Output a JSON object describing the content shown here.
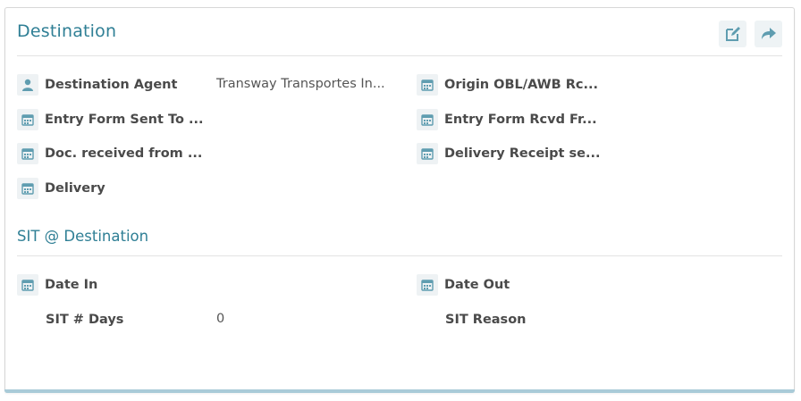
{
  "panel": {
    "title": "Destination",
    "actions": {
      "edit_icon": "edit-icon",
      "forward_icon": "share-forward-icon"
    }
  },
  "destination": {
    "left": [
      {
        "icon": "user-icon",
        "label": "Destination Agent",
        "value": "Transway Transportes In..."
      },
      {
        "icon": "calendar-icon",
        "label": "Entry Form Sent To ...",
        "value": ""
      },
      {
        "icon": "calendar-icon",
        "label": "Doc. received from ...",
        "value": ""
      },
      {
        "icon": "calendar-icon",
        "label": "Delivery",
        "value": ""
      }
    ],
    "right": [
      {
        "icon": "calendar-icon",
        "label": "Origin OBL/AWB Rc...",
        "value": ""
      },
      {
        "icon": "calendar-icon",
        "label": "Entry Form Rcvd Fr...",
        "value": ""
      },
      {
        "icon": "calendar-icon",
        "label": "Delivery Receipt se...",
        "value": ""
      }
    ]
  },
  "sit": {
    "title": "SIT @ Destination",
    "date_in": {
      "icon": "calendar-icon",
      "label": "Date In",
      "value": ""
    },
    "date_out": {
      "icon": "calendar-icon",
      "label": "Date Out",
      "value": ""
    },
    "days": {
      "label": "SIT # Days",
      "value": "0"
    },
    "reason": {
      "label": "SIT Reason",
      "value": ""
    }
  },
  "colors": {
    "accent": "#2f7f95",
    "icon": "#5f9db0",
    "bottom_bar": "#a9cbd8"
  }
}
